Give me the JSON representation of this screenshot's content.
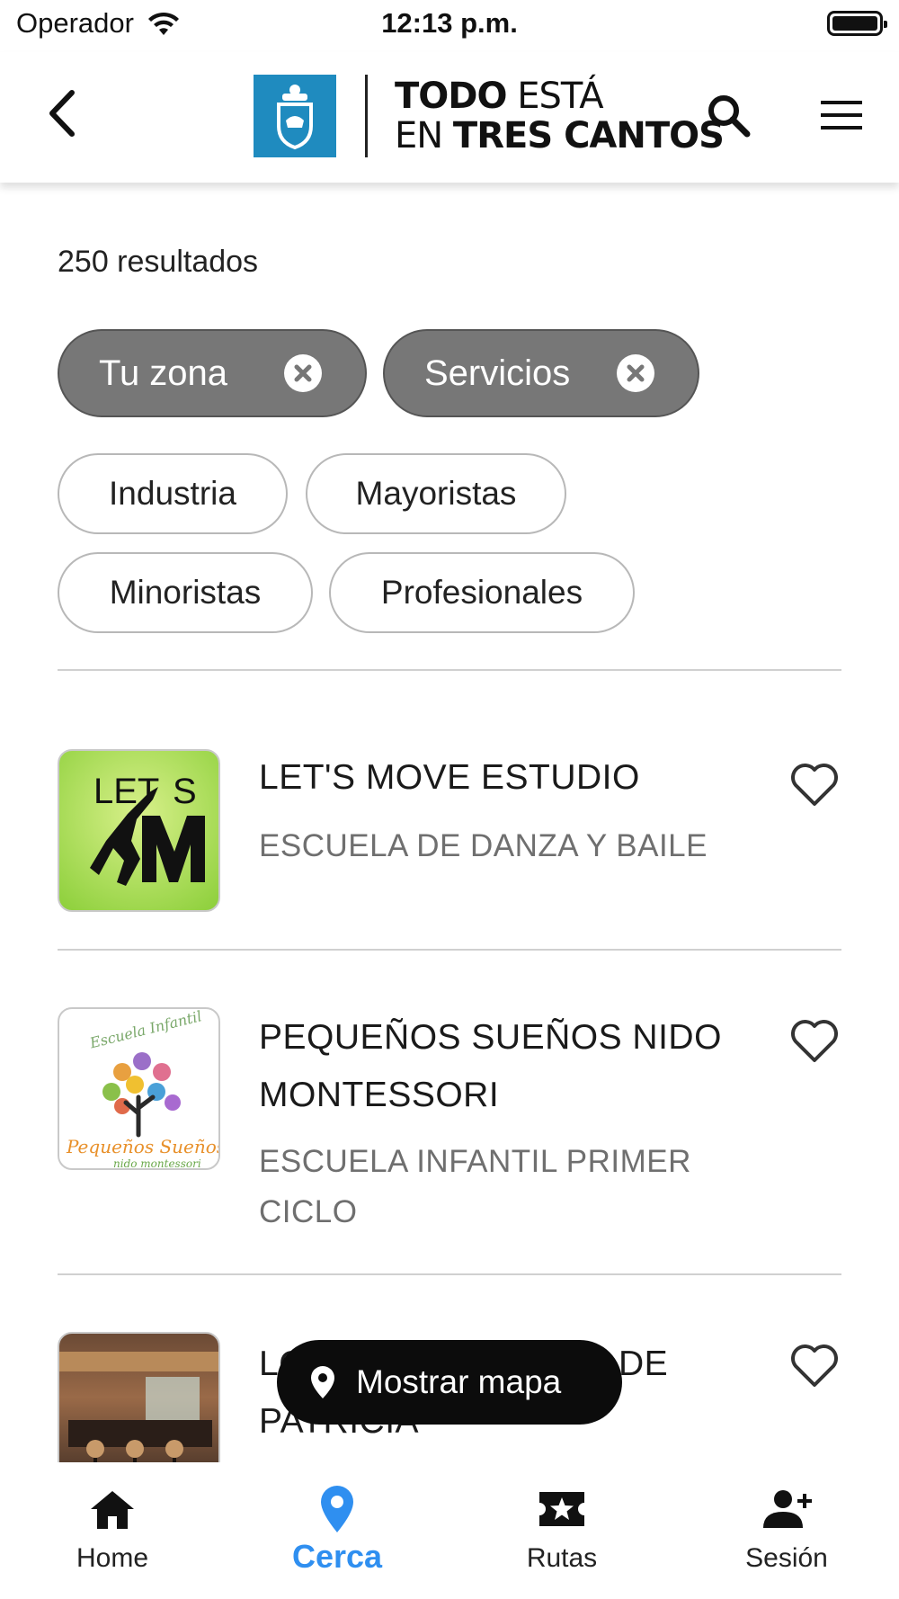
{
  "status_bar": {
    "carrier": "Operador",
    "time": "12:13 p.m."
  },
  "header": {
    "brand_line1_bold": "TODO",
    "brand_line1_light": "ESTÁ",
    "brand_line2_light": "EN",
    "brand_line2_bold": "TRES CANTOS",
    "brand_color": "#1f8bbf"
  },
  "results": {
    "count_label": "250 resultados"
  },
  "active_filters": [
    {
      "label": "Tu zona"
    },
    {
      "label": "Servicios"
    }
  ],
  "filter_options": [
    {
      "label": "Industria"
    },
    {
      "label": "Mayoristas"
    },
    {
      "label": "Minoristas"
    },
    {
      "label": "Profesionales"
    }
  ],
  "listings": [
    {
      "title": "LET'S MOVE ESTUDIO",
      "subtitle": "ESCUELA DE DANZA Y BAILE",
      "logo_text_top": "LET S",
      "logo_text_big": "M"
    },
    {
      "title_line1": "PEQUEÑOS SUEÑOS NIDO",
      "title_line2": "MONTESSORI",
      "subtitle_line1": "ESCUELA INFANTIL PRIMER",
      "subtitle_line2": "CICLO",
      "logo_text_top": "Escuela Infantil",
      "logo_text_main": "Pequeños Sueños",
      "logo_text_sub": "nido montessori"
    },
    {
      "title_line1_start": "LO",
      "title_line1_end": "DE",
      "title_line2": "PATRICIA"
    }
  ],
  "map_button": {
    "label": "Mostrar mapa"
  },
  "bottom_nav": [
    {
      "label": "Home"
    },
    {
      "label": "Cerca"
    },
    {
      "label": "Rutas"
    },
    {
      "label": "Sesión"
    }
  ],
  "colors": {
    "accent": "#2f8ff0",
    "chip_active_bg": "#777777",
    "text_secondary": "#6f6f6f"
  }
}
